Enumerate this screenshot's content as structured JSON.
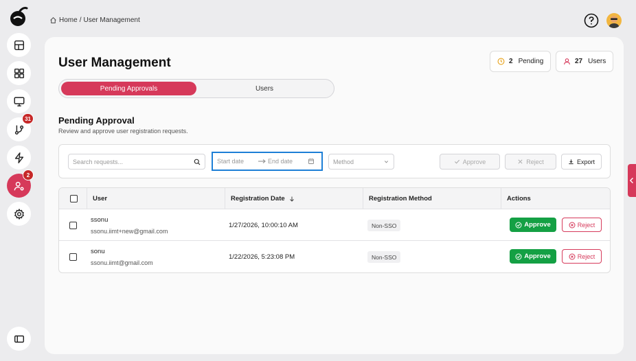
{
  "breadcrumb": {
    "home": "Home",
    "separator": "/",
    "current": "User Management"
  },
  "sidebar": {
    "items": [
      {
        "icon": "layout-icon"
      },
      {
        "icon": "grid-icon"
      },
      {
        "icon": "monitor-icon"
      },
      {
        "icon": "git-icon",
        "badge": "31"
      },
      {
        "icon": "bolt-icon"
      },
      {
        "icon": "user-settings-icon",
        "badge": "2",
        "active": true
      },
      {
        "icon": "gear-icon"
      }
    ],
    "bottom_icon": "panel-toggle-icon"
  },
  "page": {
    "title": "User Management",
    "pending_stat": {
      "count": "2",
      "label": "Pending"
    },
    "users_stat": {
      "count": "27",
      "label": "Users"
    }
  },
  "tabs": {
    "active": "Pending Approvals",
    "inactive": "Users"
  },
  "section": {
    "title": "Pending Approval",
    "subtitle": "Review and approve user registration requests."
  },
  "filters": {
    "search_placeholder": "Search requests...",
    "start_date_placeholder": "Start date",
    "end_date_placeholder": "End date",
    "method_placeholder": "Method",
    "approve_label": "Approve",
    "reject_label": "Reject",
    "export_label": "Export"
  },
  "table": {
    "headers": {
      "user": "User",
      "date": "Registration Date",
      "method": "Registration Method",
      "actions": "Actions"
    },
    "rows": [
      {
        "name": "ssonu",
        "email": "ssonu.iimt+new@gmail.com",
        "date": "1/27/2026, 10:00:10 AM",
        "method": "Non-SSO",
        "approve": "Approve",
        "reject": "Reject"
      },
      {
        "name": "sonu",
        "email": "ssonu.iimt@gmail.com",
        "date": "1/22/2026, 5:23:08 PM",
        "method": "Non-SSO",
        "approve": "Approve",
        "reject": "Reject"
      }
    ]
  },
  "colors": {
    "accent": "#d6395a",
    "approve": "#14a044",
    "focus": "#1d7fd6"
  }
}
